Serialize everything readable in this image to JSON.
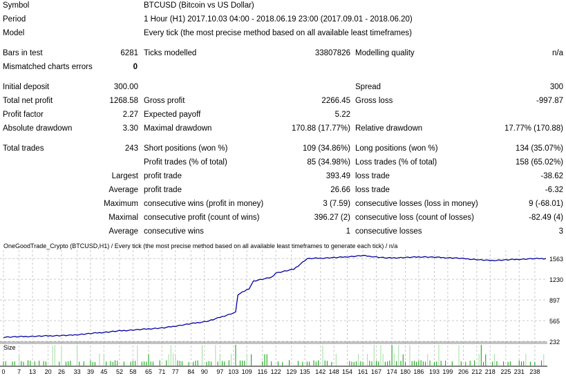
{
  "report": {
    "symbol_label": "Symbol",
    "symbol": "BTCUSD (Bitcoin vs US Dollar)",
    "period_label": "Period",
    "period": "1 Hour (H1) 2017.10.03 04:00 - 2018.06.19 23:00 (2017.09.01 - 2018.06.20)",
    "model_label": "Model",
    "model": "Every tick (the most precise method based on all available least timeframes)",
    "bars_label": "Bars in test",
    "bars": "6281",
    "ticks_label": "Ticks modelled",
    "ticks": "33807826",
    "quality_label": "Modelling quality",
    "quality": "n/a",
    "mismatch_label": "Mismatched charts errors",
    "mismatch": "0",
    "deposit_label": "Initial deposit",
    "deposit": "300.00",
    "spread_label": "Spread",
    "spread": "300",
    "net_label": "Total net profit",
    "net": "1268.58",
    "gp_label": "Gross profit",
    "gp": "2266.45",
    "gl_label": "Gross loss",
    "gl": "-997.87",
    "pf_label": "Profit factor",
    "pf": "2.27",
    "ep_label": "Expected payoff",
    "ep": "5.22",
    "ad_label": "Absolute drawdown",
    "ad": "3.30",
    "md_label": "Maximal drawdown",
    "md": "170.88 (17.77%)",
    "rd_label": "Relative drawdown",
    "rd": "17.77% (170.88)",
    "tt_label": "Total trades",
    "tt": "243",
    "sp_label": "Short positions (won %)",
    "sp": "109 (34.86%)",
    "lp_label": "Long positions (won %)",
    "lp": "134 (35.07%)",
    "pt_label": "Profit trades (% of total)",
    "pt": "85 (34.98%)",
    "lt_label": "Loss trades (% of total)",
    "lt": "158 (65.02%)",
    "largest": "Largest",
    "lpt_label": "profit trade",
    "lpt": "393.49",
    "llt_label": "loss trade",
    "llt": "-38.62",
    "average": "Average",
    "apt_label": "profit trade",
    "apt": "26.66",
    "alt_label": "loss trade",
    "alt": "-6.32",
    "maximum": "Maximum",
    "mcw_label": "consecutive wins (profit in money)",
    "mcw": "3 (7.59)",
    "mcl_label": "consecutive losses (loss in money)",
    "mcl": "9 (-68.01)",
    "maximal": "Maximal",
    "mcp_label": "consecutive profit (count of wins)",
    "mcp": "396.27 (2)",
    "mcll_label": "consecutive loss (count of losses)",
    "mcll": "-82.49 (4)",
    "average2": "Average",
    "acw_label": "consecutive wins",
    "acw": "1",
    "acl_label": "consecutive losses",
    "acl": "3"
  },
  "chart": {
    "title": "OneGoodTrade_Crypto (BTCUSD,H1) / Every tick (the most precise method based on all available least timeframes to generate each tick) / n/a",
    "size_label": "Size",
    "y_ticks": [
      "1563",
      "1230",
      "897",
      "565",
      "232"
    ],
    "x_ticks": [
      "0",
      "7",
      "13",
      "20",
      "26",
      "33",
      "39",
      "45",
      "52",
      "58",
      "65",
      "71",
      "77",
      "84",
      "90",
      "97",
      "103",
      "109",
      "116",
      "122",
      "129",
      "135",
      "142",
      "148",
      "154",
      "161",
      "167",
      "174",
      "180",
      "186",
      "193",
      "199",
      "206",
      "212",
      "218",
      "225",
      "231",
      "238"
    ],
    "balance": [
      [
        0,
        300
      ],
      [
        30,
        330
      ],
      [
        52,
        400
      ],
      [
        72,
        450
      ],
      [
        92,
        560
      ],
      [
        104,
        700
      ],
      [
        105,
        980
      ],
      [
        110,
        1080
      ],
      [
        112,
        1200
      ],
      [
        120,
        1260
      ],
      [
        122,
        1330
      ],
      [
        130,
        1390
      ],
      [
        136,
        1560
      ],
      [
        150,
        1580
      ],
      [
        161,
        1610
      ],
      [
        172,
        1570
      ],
      [
        188,
        1590
      ],
      [
        203,
        1570
      ],
      [
        218,
        1530
      ],
      [
        237,
        1560
      ],
      [
        243,
        1563
      ]
    ],
    "line_color": "#0000a0",
    "size_color": "#00a000"
  }
}
